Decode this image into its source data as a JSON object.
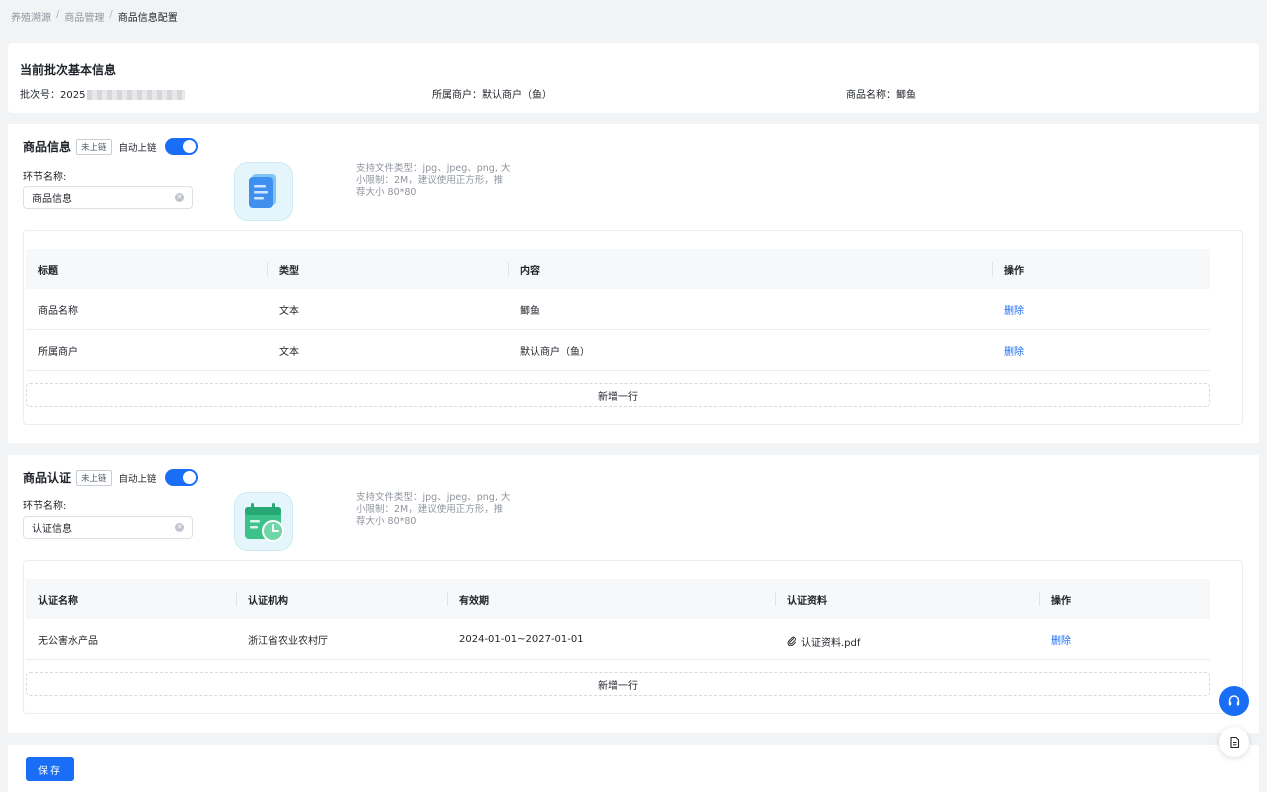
{
  "breadcrumb": {
    "items": [
      "养殖溯源",
      "商品管理",
      "商品信息配置"
    ],
    "separator": "/"
  },
  "basic": {
    "title": "当前批次基本信息",
    "batch_label": "批次号：",
    "batch_value": "2025",
    "merchant_label": "所属商户：",
    "merchant_value": "默认商户（鱼）",
    "product_label": "商品名称：",
    "product_value": "鲫鱼"
  },
  "section1": {
    "title": "商品信息",
    "tag": "未上链",
    "auto_label": "自动上链",
    "toggle_on": true,
    "field_label": "环节名称:",
    "field_value": "商品信息",
    "icon": "document-icon",
    "hint": "支持文件类型：jpg、jpeg、png, 大小限制：2M，建议使用正方形，推荐大小 80*80",
    "columns": [
      "标题",
      "类型",
      "内容",
      "操作"
    ],
    "rows": [
      {
        "title": "商品名称",
        "type": "文本",
        "content": "鲫鱼",
        "action": "删除"
      },
      {
        "title": "所属商户",
        "type": "文本",
        "content": "默认商户（鱼）",
        "action": "删除"
      }
    ],
    "add_row": "新增一行"
  },
  "section2": {
    "title": "商品认证",
    "tag": "未上链",
    "auto_label": "自动上链",
    "toggle_on": true,
    "field_label": "环节名称:",
    "field_value": "认证信息",
    "icon": "calendar-clock-icon",
    "hint": "支持文件类型：jpg、jpeg、png, 大小限制：2M，建议使用正方形，推荐大小 80*80",
    "columns": [
      "认证名称",
      "认证机构",
      "有效期",
      "认证资料",
      "操作"
    ],
    "rows": [
      {
        "name": "无公害水产品",
        "org": "浙江省农业农村厅",
        "period": "2024-01-01~2027-01-01",
        "file": "认证资料.pdf",
        "action": "删除"
      }
    ],
    "add_row": "新增一行"
  },
  "footer": {
    "save": "保存"
  },
  "floating": {
    "support_icon": "headset-icon",
    "doc_icon": "document-icon"
  },
  "colors": {
    "primary": "#1a6df5",
    "background": "#f2f3f5"
  }
}
